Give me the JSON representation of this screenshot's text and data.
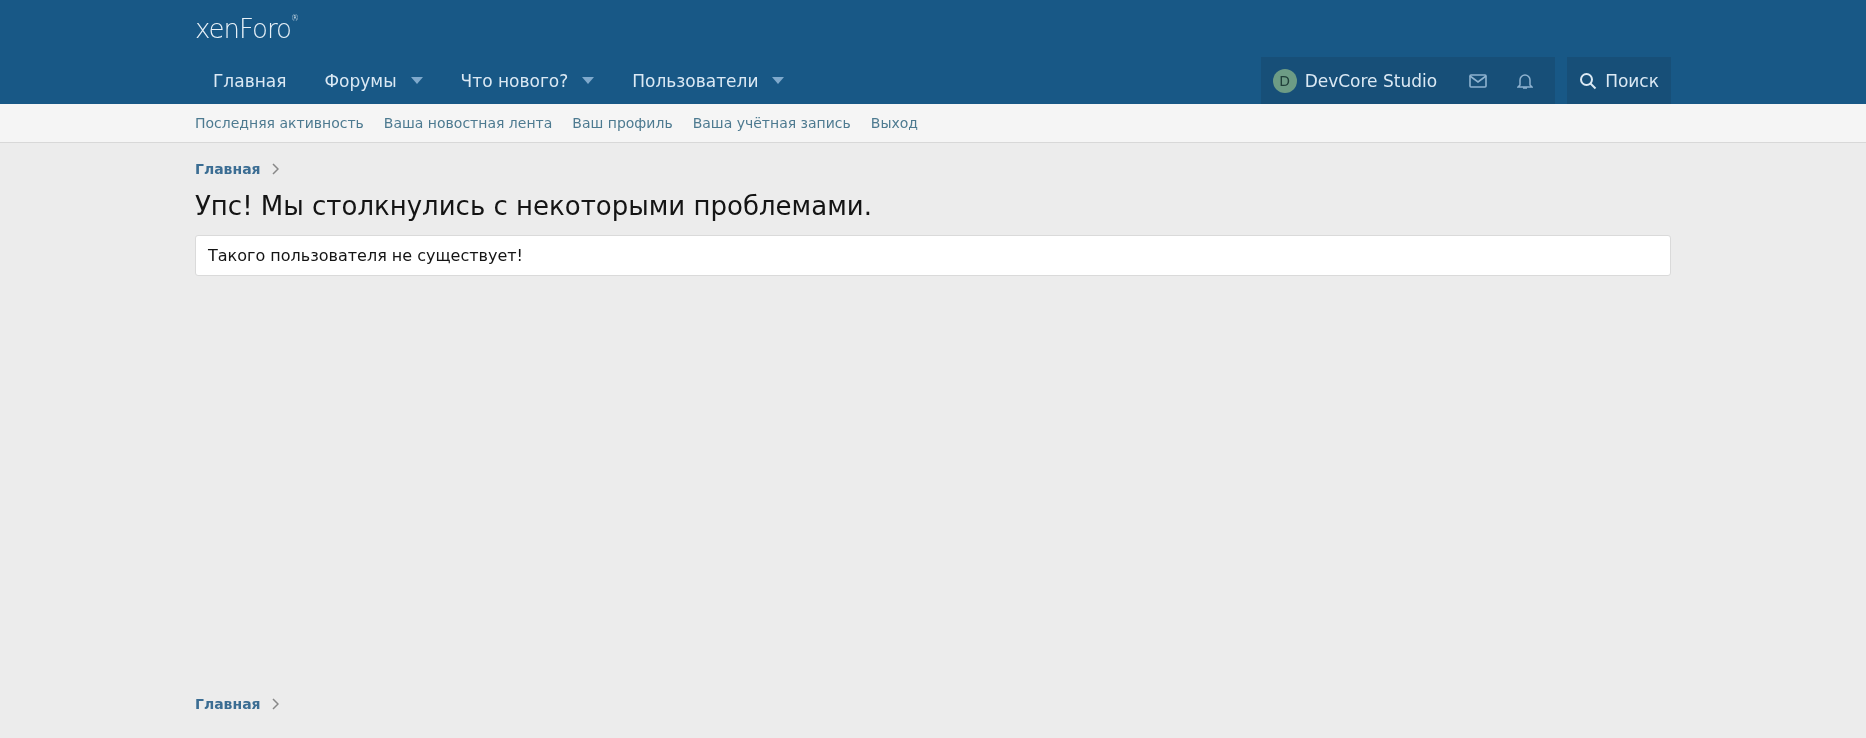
{
  "logo": {
    "text": "xenForo$^{®}$"
  },
  "nav": [
    {
      "label": "Главная",
      "has_menu": false
    },
    {
      "label": "Форумы",
      "has_menu": true
    },
    {
      "label": "Что нового?",
      "has_menu": true
    },
    {
      "label": "Пользователи",
      "has_menu": true
    }
  ],
  "account": {
    "avatar_letter": "D",
    "name": "DevCore Studio"
  },
  "search": {
    "label": "Поиск"
  },
  "subnav": [
    "Последняя активность",
    "Ваша новостная лента",
    "Ваш профиль",
    "Ваша учётная запись",
    "Выход"
  ],
  "breadcrumb_top": [
    "Главная"
  ],
  "title": "Упс! Мы столкнулись с некоторыми проблемами.",
  "message": "Такого пользователя не существует!",
  "breadcrumb_bottom": [
    "Главная"
  ]
}
